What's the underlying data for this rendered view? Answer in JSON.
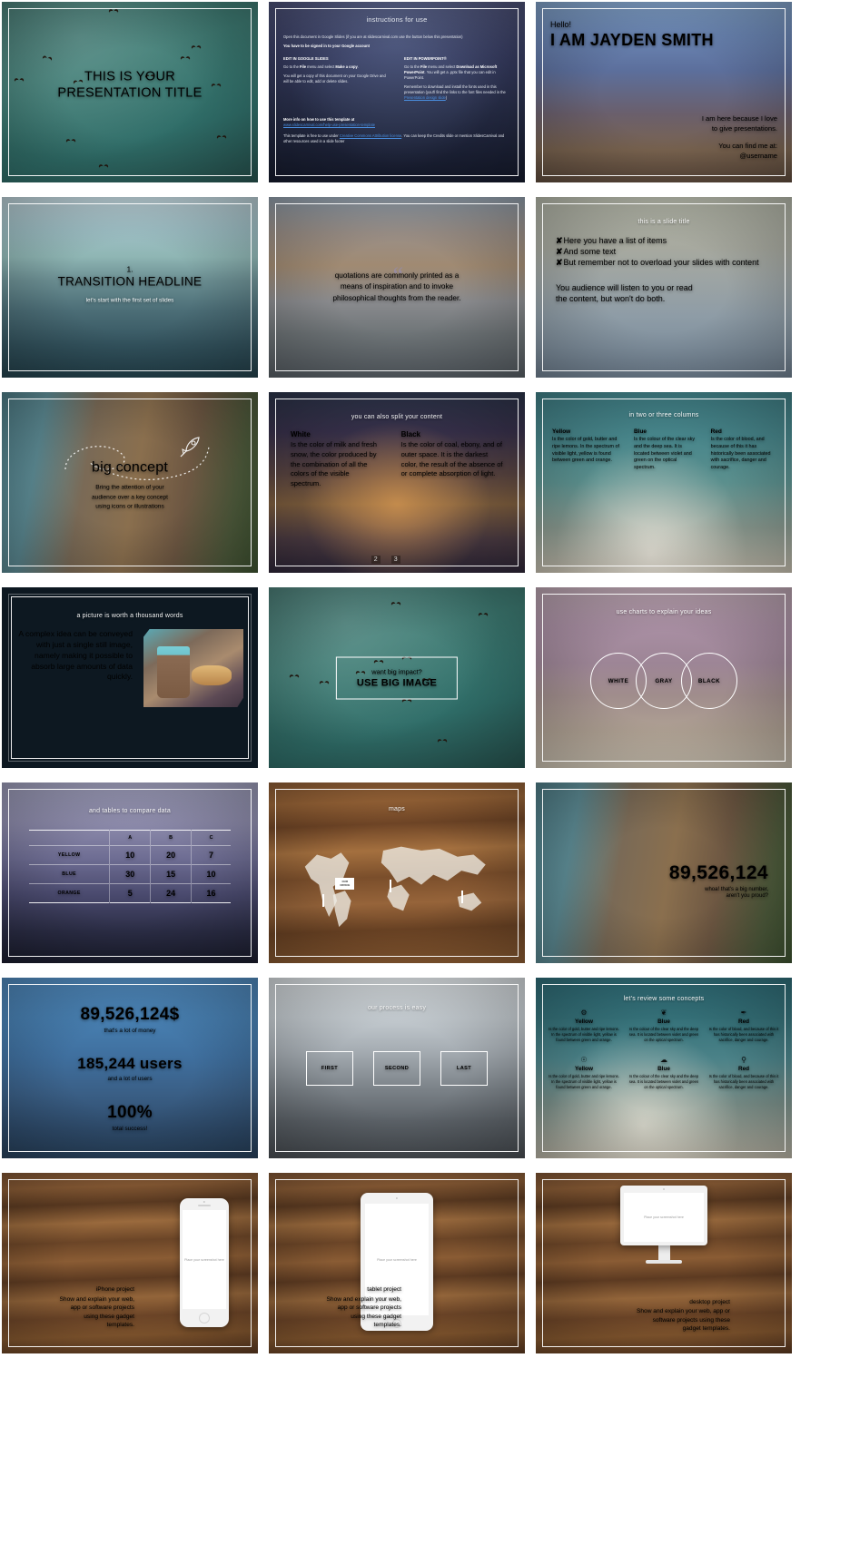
{
  "deck": {
    "slides": [
      {
        "id": "title",
        "title_line1": "THIS IS YOUR",
        "title_line2": "PRESENTATION TITLE"
      },
      {
        "id": "instructions",
        "heading": "instructions for use",
        "intro": "Open this document in Google Slides (if you are at slidescarnival.com use the button below this presentation)",
        "signin": "You have to be signed in to your Google account",
        "left_heading": "EDIT IN GOOGLE SLIDES",
        "left_p1_a": "Go to the ",
        "left_p1_b": "File",
        "left_p1_c": " menu and select ",
        "left_p1_d": "Make a copy",
        "left_p1_e": ".",
        "left_p2": "You will get a copy of this document on your Google Drive and will be able to edit, add or delete slides.",
        "right_heading": "EDIT IN POWERPOINT®",
        "right_p1_a": "Go to the ",
        "right_p1_b": "File",
        "right_p1_c": " menu and select ",
        "right_p1_d": "Download as Microsoft PowerPoint",
        "right_p1_e": ". You will get a .pptx file that you can edit in PowerPoint.",
        "right_p2_a": "Remember to download and install the fonts used in this presentation (you'll find the links to the font files needed in the ",
        "right_p2_link": "Presentation design slide",
        "right_p2_b": ")",
        "more_info": "More info on how to use this template at",
        "more_link": "www.slidescarnival.com/help-use-presentation-template",
        "license_a": "This template is free to use under ",
        "license_link": "Creative Commons Attribution license",
        "license_b": ". You can keep the Credits slide or mention SlidesCarnival and other resources used in a slide footer"
      },
      {
        "id": "hello",
        "greeting": "Hello!",
        "name": "I AM JAYDEN SMITH",
        "line1": "I am here because I love",
        "line2": "to give presentations.",
        "line3": "You can find me at:",
        "line4": "@username"
      },
      {
        "id": "transition",
        "number": "1.",
        "headline": "TRANSITION HEADLINE",
        "subtitle": "let's start with the first set of slides"
      },
      {
        "id": "quote",
        "line1": "quotations are commonly printed as a",
        "line2": "means of inspiration and to invoke",
        "line3": "philosophical thoughts from the reader."
      },
      {
        "id": "list",
        "title": "this is a slide title",
        "bullet_mark": "✘",
        "items": [
          "Here you have a list of items",
          "And some text",
          "But remember not to overload your slides with content"
        ],
        "note_line1": "You audience will listen to you or read",
        "note_line2": "the content, but won't do both."
      },
      {
        "id": "big-concept",
        "title": "big concept",
        "desc_line1": "Bring the attention of your",
        "desc_line2": "audience over a key concept",
        "desc_line3": "using icons or illustrations"
      },
      {
        "id": "split-content",
        "title": "you can also split your content",
        "columns": [
          {
            "heading": "White",
            "body": "Is the color of milk and fresh snow, the color produced by the combination of all the colors of the visible spectrum."
          },
          {
            "heading": "Black",
            "body": "Is the color of coal, ebony, and of outer space. It is the darkest color, the result of the absence of or complete absorption of light."
          }
        ],
        "road_markers": [
          "2",
          "3"
        ]
      },
      {
        "id": "three-columns",
        "title": "in two or three columns",
        "columns": [
          {
            "heading": "Yellow",
            "body": "Is the color of gold, butter and ripe lemons. In the spectrum of visible light, yellow is found between green and orange."
          },
          {
            "heading": "Blue",
            "body": "Is the colour of the clear sky and the deep sea. It is located between violet and green on the optical spectrum."
          },
          {
            "heading": "Red",
            "body": "Is the color of blood, and because of this it has historically been associated with sacrifice, danger and courage."
          }
        ]
      },
      {
        "id": "picture-words",
        "title": "a picture is worth a thousand words",
        "body": "A complex idea can be conveyed with just a single still image, namely making it possible to absorb large amounts of data quickly."
      },
      {
        "id": "big-image",
        "line1": "want big impact?",
        "line2": "USE BIG IMAGE"
      },
      {
        "id": "charts-venn",
        "title": "use charts to explain your ideas",
        "circles": [
          "WHITE",
          "GRAY",
          "BLACK"
        ]
      },
      {
        "id": "table",
        "title": "and tables to compare data",
        "columns": [
          "",
          "A",
          "B",
          "C"
        ],
        "rows": [
          {
            "label": "YELLOW",
            "values": [
              "10",
              "20",
              "7"
            ]
          },
          {
            "label": "BLUE",
            "values": [
              "30",
              "15",
              "10"
            ]
          },
          {
            "label": "ORANGE",
            "values": [
              "5",
              "24",
              "16"
            ]
          }
        ]
      },
      {
        "id": "maps",
        "title": "maps",
        "badge_line1": "OUR",
        "badge_line2": "OFFICE"
      },
      {
        "id": "big-number",
        "number": "89,526,124",
        "sub_line1": "whoa! that's a big number,",
        "sub_line2": "aren't you proud?"
      },
      {
        "id": "stats",
        "stats": [
          {
            "number": "89,526,124$",
            "label": "that's a lot of money"
          },
          {
            "number": "185,244 users",
            "label": "and a lot of users"
          },
          {
            "number": "100%",
            "label": "total success!"
          }
        ]
      },
      {
        "id": "process",
        "title": "our process is easy",
        "steps": [
          "FIRST",
          "SECOND",
          "LAST"
        ]
      },
      {
        "id": "review-concepts",
        "title": "let's review some concepts",
        "rows": [
          [
            {
              "icon": "lightbulb-icon",
              "glyph": "⚙",
              "heading": "Yellow",
              "body": "Is the color of gold, butter and ripe lemons. In the spectrum of visible light, yellow is found between green and orange."
            },
            {
              "icon": "leaf-icon",
              "glyph": "❦",
              "heading": "Blue",
              "body": "Is the colour of the clear sky and the deep sea. It is located between violet and green on the optical spectrum."
            },
            {
              "icon": "feather-icon",
              "glyph": "✒",
              "heading": "Red",
              "body": "Is the color of blood, and because of this it has historically been associated with sacrifice, danger and courage."
            }
          ],
          [
            {
              "icon": "camera-icon",
              "glyph": "☉",
              "heading": "Yellow",
              "body": "Is the color of gold, butter and ripe lemons. In the spectrum of visible light, yellow is found between green and orange."
            },
            {
              "icon": "cloud-icon",
              "glyph": "☁",
              "heading": "Blue",
              "body": "Is the colour of the clear sky and the deep sea. It is located between violet and green on the optical spectrum."
            },
            {
              "icon": "bicycle-icon",
              "glyph": "⚲",
              "heading": "Red",
              "body": "Is the color of blood, and because of this it has historically been associated with sacrifice, danger and courage."
            }
          ]
        ]
      },
      {
        "id": "iphone-project",
        "title": "iPhone project",
        "body_line1": "Show and explain your web,",
        "body_line2": "app or software projects",
        "body_line3": "using these gadget",
        "body_line4": "templates.",
        "placeholder": "Place your screenshot here"
      },
      {
        "id": "tablet-project",
        "title": "tablet project",
        "body_line1": "Show and explain your web,",
        "body_line2": "app or software projects",
        "body_line3": "using these gadget",
        "body_line4": "templates.",
        "placeholder": "Place your screenshot here"
      },
      {
        "id": "desktop-project",
        "title": "desktop project",
        "body_line1": "Show and explain your web, app or",
        "body_line2": "software projects using these",
        "body_line3": "gadget templates.",
        "placeholder": "Place your screenshot here"
      }
    ]
  },
  "colors": {
    "frame": "#ffffff",
    "link": "#4a8fe0",
    "dark_slide": "#0d1821"
  }
}
